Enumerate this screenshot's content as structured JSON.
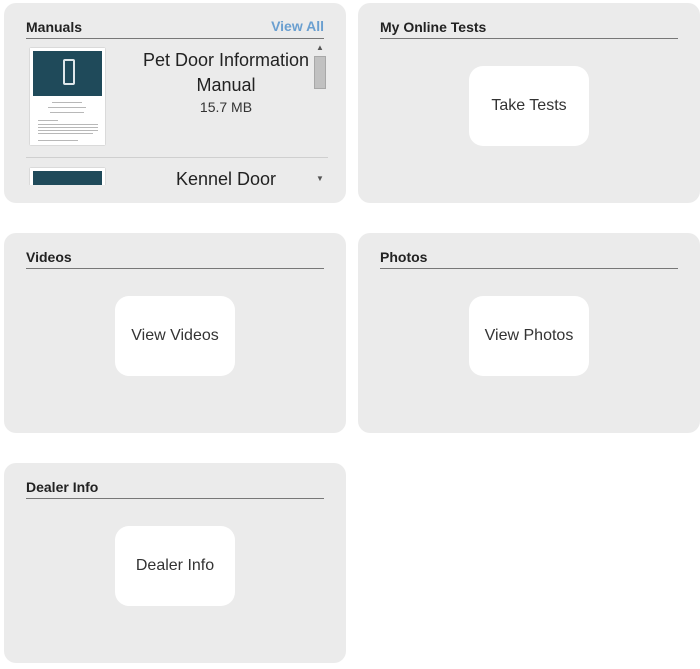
{
  "manuals": {
    "title": "Manuals",
    "view_all": "View All",
    "items": [
      {
        "title": "Pet Door Information Manual",
        "size": "15.7 MB"
      },
      {
        "title": "Kennel Door"
      }
    ],
    "scroll_up_icon": "▲",
    "scroll_down_icon": "▼"
  },
  "online_tests": {
    "title": "My Online Tests",
    "button": "Take Tests"
  },
  "videos": {
    "title": "Videos",
    "button": "View Videos"
  },
  "photos": {
    "title": "Photos",
    "button": "View Photos"
  },
  "dealer_info": {
    "title": "Dealer Info",
    "button": "Dealer Info"
  },
  "colors": {
    "card_bg": "#ebebeb",
    "link": "#6a9fd0",
    "button_bg": "#ffffff"
  }
}
